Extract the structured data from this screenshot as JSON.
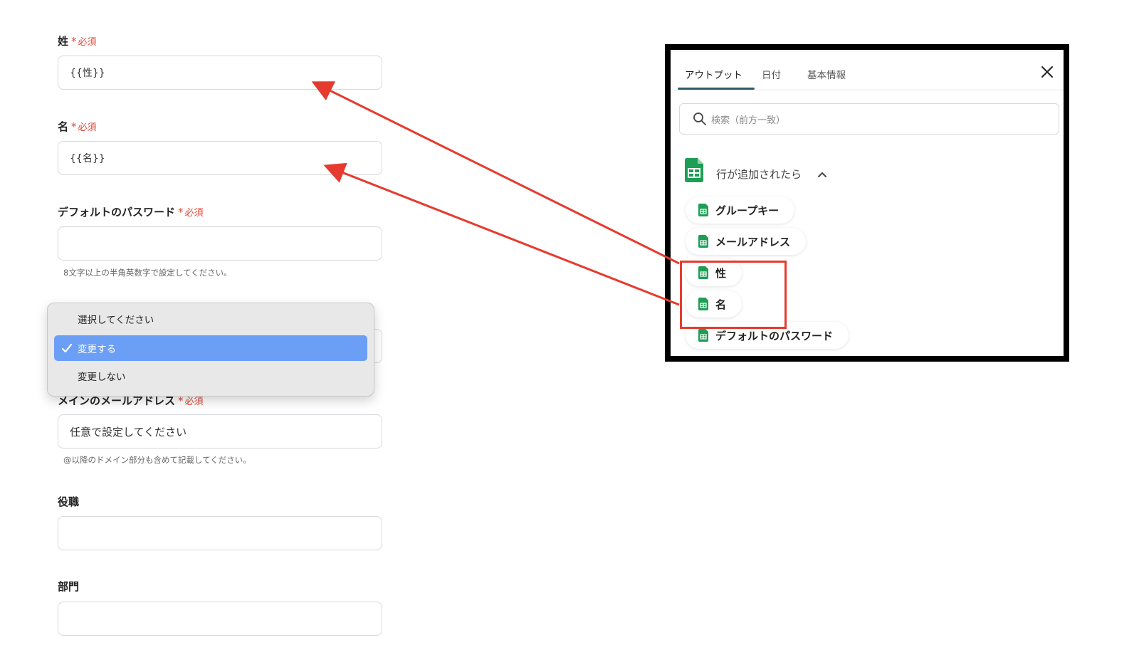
{
  "form": {
    "last_name": {
      "label": "姓",
      "required": "必須",
      "value": "{{性}}"
    },
    "first_name": {
      "label": "名",
      "required": "必須",
      "value": "{{名}}"
    },
    "password": {
      "label": "デフォルトのパスワード",
      "required": "必須",
      "value": "",
      "hint": "8文字以上の半角英数字で設定してください。"
    },
    "email": {
      "label": "メインのメールアドレス",
      "required": "必須",
      "placeholder": "任意で設定してください",
      "hint": "@以降のドメイン部分も含めて記載してください。"
    },
    "title": {
      "label": "役職",
      "value": ""
    },
    "department": {
      "label": "部門",
      "value": ""
    },
    "required_mark": "*"
  },
  "dropdown": {
    "options": [
      "選択してください",
      "変更する",
      "変更しない"
    ],
    "selected": "変更する"
  },
  "panel": {
    "tabs": [
      "アウトプット",
      "日付",
      "基本情報"
    ],
    "active_tab": "アウトプット",
    "search_placeholder": "検索（前方一致）",
    "group_title": "行が追加されたら",
    "items": [
      "グループキー",
      "メールアドレス",
      "性",
      "名",
      "デフォルトのパスワード"
    ],
    "highlighted_items": [
      "性",
      "名"
    ]
  },
  "colors": {
    "accent_red": "#e53b2f",
    "selected_blue": "#6b9ef5",
    "sheets_green": "#1e9e55",
    "tab_underline": "#2e5d6a"
  },
  "icons": {
    "search": "search-icon",
    "close": "close-icon",
    "sheets": "google-sheets-icon",
    "chevron": "chevron-up-icon",
    "check": "check-icon"
  }
}
